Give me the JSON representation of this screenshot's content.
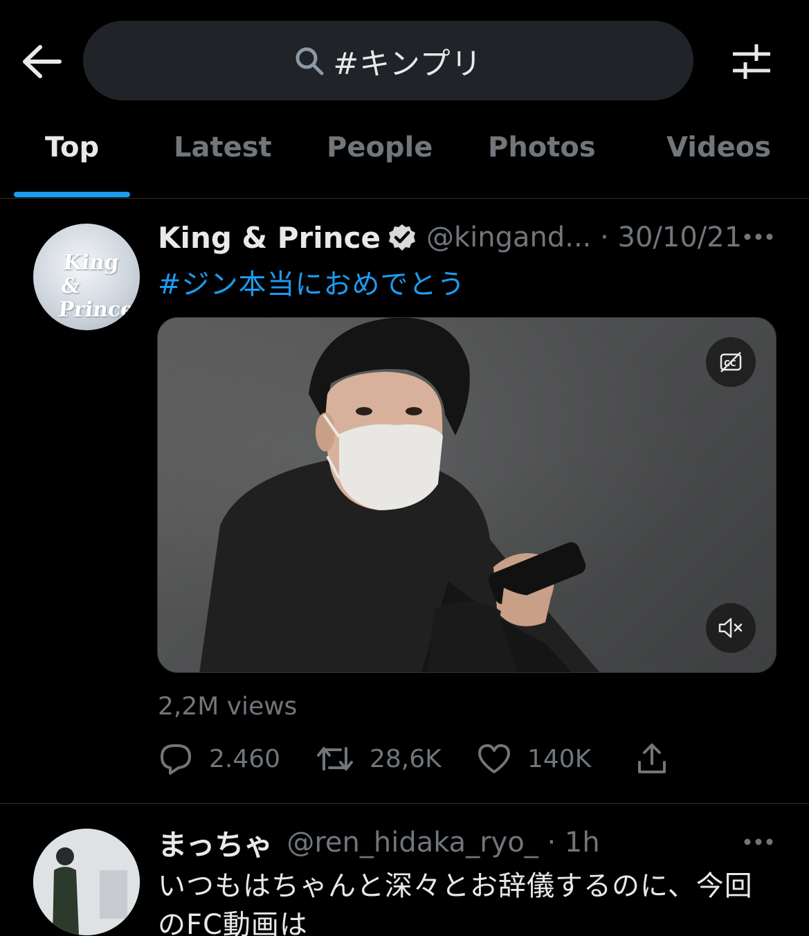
{
  "search": {
    "query": "#キンプリ"
  },
  "tabs": [
    {
      "label": "Top"
    },
    {
      "label": "Latest"
    },
    {
      "label": "People"
    },
    {
      "label": "Photos"
    },
    {
      "label": "Videos"
    }
  ],
  "active_tab": "Top",
  "accent_color": "#1d9bf0",
  "tweets": [
    {
      "display_name": "King & Prince",
      "verified": true,
      "handle_date": "@kingand... · 30/10/21",
      "text": "#ジン本当におめでとう",
      "avatar_logo": "King & Prince",
      "media": {
        "type": "video",
        "captions_icon": "cc-off-icon",
        "mute_icon": "muted-speaker-icon"
      },
      "views": "2,2M views",
      "replies": "2.460",
      "retweets": "28,6K",
      "likes": "140K"
    },
    {
      "display_name": "まっちゃ",
      "handle_date": "@ren_hidaka_ryo_ · 1h",
      "text": "いつもはちゃんと深々とお辞儀するのに、今回のFC動画は"
    }
  ]
}
